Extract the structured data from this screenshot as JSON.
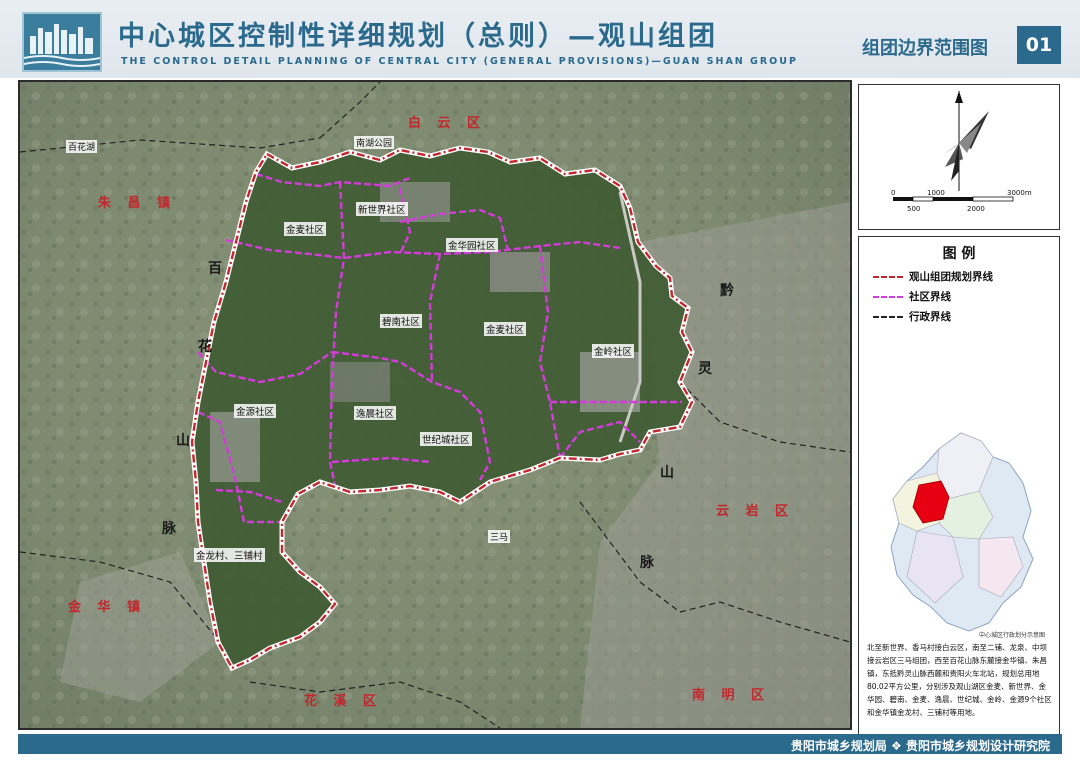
{
  "header": {
    "title_cn": "中心城区控制性详细规划（总则）—观山组团",
    "title_en": "THE CONTROL DETAIL PLANNING OF CENTRAL CITY (GENERAL PROVISIONS)—GUAN SHAN GROUP",
    "sheet_title": "组团边界范围图",
    "sheet_no": "01"
  },
  "map": {
    "districts": {
      "baiyun": "白 云 区",
      "zhuchang": "朱 昌 镇",
      "jinhua": "金 华 镇",
      "huaxi": "花 溪 区",
      "yunyan": "云 岩 区",
      "nanming": "南 明 区"
    },
    "mountains": {
      "baihua": [
        "百",
        "花",
        "山",
        "脉"
      ],
      "qianling": [
        "黔",
        "灵",
        "山",
        "脉"
      ]
    },
    "places": {
      "baihuahu": "百花湖",
      "nanhu_park": "南湖公园",
      "sanma": "三马"
    },
    "communities": {
      "jinmai": "金麦社区",
      "xinshijie": "新世界社区",
      "jinhuayuan": "金华园社区",
      "guanshan": "碧南社区",
      "jinyang": "金麦社区",
      "jinling": "金岭社区",
      "jinyuan": "金源社区",
      "yixin": "逸晨社区",
      "shijicheng": "世纪城社区",
      "jinlong": "金龙村、三铺村"
    }
  },
  "north_panel": {
    "scale_labels_top": [
      "0",
      "1000",
      "3000m"
    ],
    "scale_labels_bottom": [
      "500",
      "2000"
    ]
  },
  "legend": {
    "title": "图 例",
    "items": [
      {
        "label": "观山组团规划界线",
        "color": "#c1272d",
        "style": "dash-dot"
      },
      {
        "label": "社区界线",
        "color": "#d23cd8",
        "style": "dash"
      },
      {
        "label": "行政界线",
        "color": "#222222",
        "style": "dash"
      }
    ]
  },
  "inset": {
    "note": "中心城区行政划分示意图"
  },
  "description": "北至新世界、香马村接白云区，南至二铺、龙泉、中坝接云岩区三马组团，西至百花山脉东麓接金华镇、朱昌镇，东抵黔灵山脉西麓和贵阳火车北站，规划总用地80.02平方公里，分别涉及观山湖区金麦、新世界、金华园、碧南、金麦、逸晨、世纪城、金岭、金源9个社区和金华镇金龙村、三铺村等用地。",
  "footer": {
    "text": "贵阳市城乡规划局 ❖ 贵阳市城乡规划设计研究院"
  }
}
